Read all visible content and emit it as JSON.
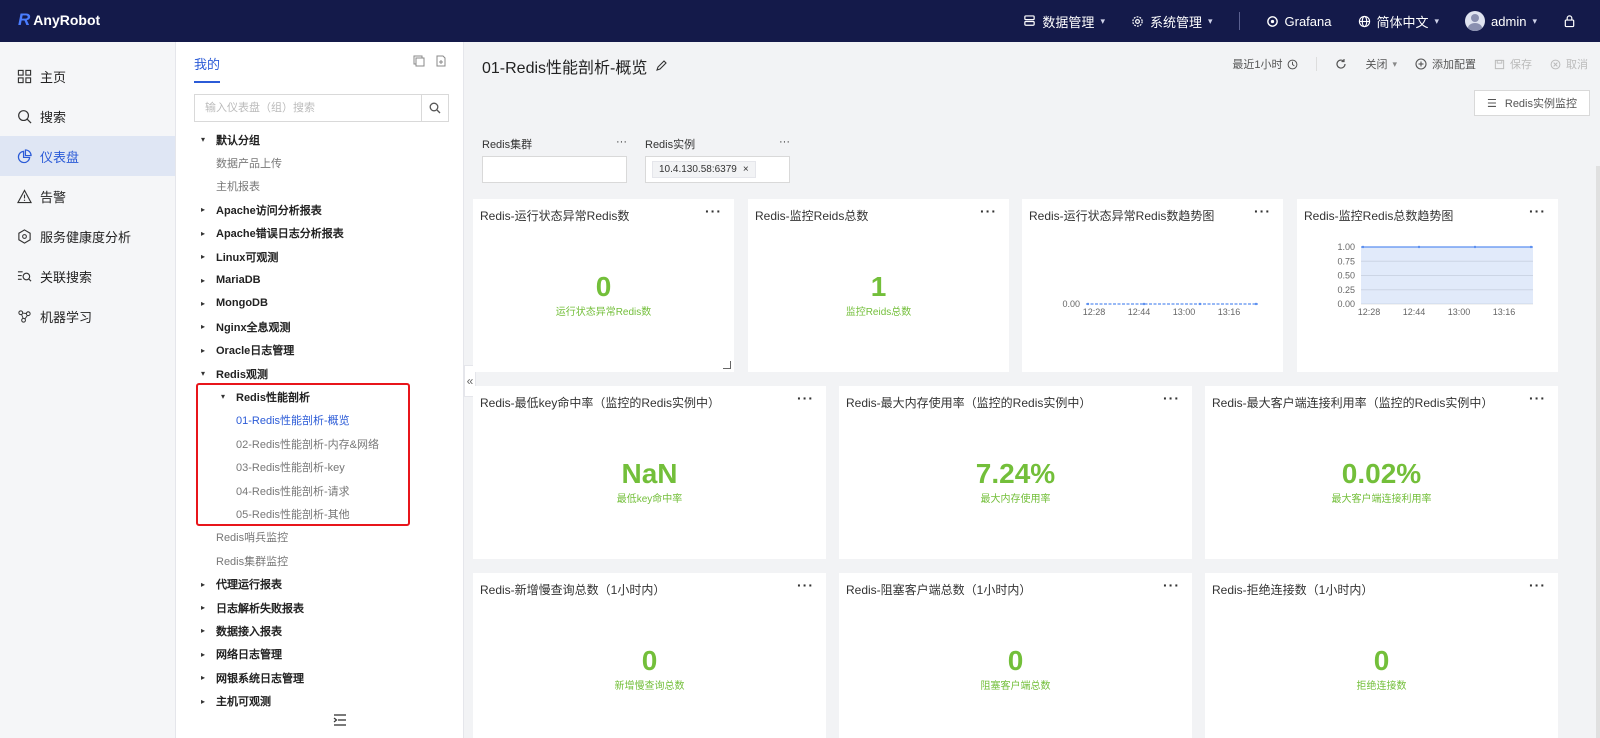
{
  "topbar": {
    "logo_mark": "R",
    "logo_text": "AnyRobot",
    "items": [
      {
        "label": "数据管理",
        "icon": "database-icon"
      },
      {
        "label": "系统管理",
        "icon": "gear-icon"
      },
      {
        "label": "Grafana",
        "icon": "grafana-icon"
      },
      {
        "label": "简体中文",
        "icon": "globe-icon"
      }
    ],
    "user": "admin"
  },
  "leftnav": {
    "items": [
      {
        "label": "主页",
        "icon": "grid-icon"
      },
      {
        "label": "搜索",
        "icon": "search-icon"
      },
      {
        "label": "仪表盘",
        "icon": "pie-chart-icon",
        "active": true
      },
      {
        "label": "告警",
        "icon": "warning-icon"
      },
      {
        "label": "服务健康度分析",
        "icon": "cube-icon"
      },
      {
        "label": "关联搜索",
        "icon": "related-search-icon"
      },
      {
        "label": "机器学习",
        "icon": "ml-icon"
      }
    ]
  },
  "tree": {
    "tab": "我的",
    "search_placeholder": "输入仪表盘（组）搜索",
    "rows": [
      {
        "label": "默认分组",
        "kind": "lv0",
        "arrow": "▾"
      },
      {
        "label": "数据产品上传",
        "kind": "leaf0"
      },
      {
        "label": "主机报表",
        "kind": "leaf0"
      },
      {
        "label": "Apache访问分析报表",
        "kind": "lv0",
        "arrow": "▸"
      },
      {
        "label": "Apache错误日志分析报表",
        "kind": "lv0",
        "arrow": "▸"
      },
      {
        "label": "Linux可观测",
        "kind": "lv0",
        "arrow": "▸"
      },
      {
        "label": "MariaDB",
        "kind": "lv0",
        "arrow": "▸"
      },
      {
        "label": "MongoDB",
        "kind": "lv0",
        "arrow": "▸"
      },
      {
        "label": "Nginx全息观测",
        "kind": "lv0",
        "arrow": "▸"
      },
      {
        "label": "Oracle日志管理",
        "kind": "lv0",
        "arrow": "▸"
      },
      {
        "label": "Redis观测",
        "kind": "lv0",
        "arrow": "▾"
      },
      {
        "label": "Redis性能剖析",
        "kind": "lv1",
        "arrow": "▾"
      },
      {
        "label": "01-Redis性能剖析-概览",
        "kind": "leaf1",
        "selected": true
      },
      {
        "label": "02-Redis性能剖析-内存&网络",
        "kind": "leaf1"
      },
      {
        "label": "03-Redis性能剖析-key",
        "kind": "leaf1"
      },
      {
        "label": "04-Redis性能剖析-请求",
        "kind": "leaf1"
      },
      {
        "label": "05-Redis性能剖析-其他",
        "kind": "leaf1"
      },
      {
        "label": "Redis哨兵监控",
        "kind": "leaf0"
      },
      {
        "label": "Redis集群监控",
        "kind": "leaf0"
      },
      {
        "label": "代理运行报表",
        "kind": "lv0",
        "arrow": "▸"
      },
      {
        "label": "日志解析失败报表",
        "kind": "lv0",
        "arrow": "▸"
      },
      {
        "label": "数据接入报表",
        "kind": "lv0",
        "arrow": "▸"
      },
      {
        "label": "网络日志管理",
        "kind": "lv0",
        "arrow": "▸"
      },
      {
        "label": "网银系统日志管理",
        "kind": "lv0",
        "arrow": "▸"
      },
      {
        "label": "主机可观测",
        "kind": "lv0",
        "arrow": "▸"
      }
    ]
  },
  "main": {
    "title": "01-Redis性能剖析-概览",
    "toolbar": {
      "time_range": "最近1小时",
      "refresh": "关闭",
      "add_config": "添加配置",
      "save": "保存",
      "cancel": "取消"
    },
    "redis_btn": "Redis实例监控",
    "vars": [
      {
        "label": "Redis集群",
        "value": ""
      },
      {
        "label": "Redis实例",
        "value": "10.4.130.58:6379"
      }
    ],
    "panels": [
      {
        "title": "Redis-运行状态异常Redis数",
        "value": "0",
        "label": "运行状态异常Redis数"
      },
      {
        "title": "Redis-监控Reids总数",
        "value": "1",
        "label": "监控Reids总数"
      },
      {
        "title": "Redis-运行状态异常Redis数趋势图"
      },
      {
        "title": "Redis-监控Redis总数趋势图"
      },
      {
        "title": "Redis-最低key命中率（监控的Redis实例中）",
        "value": "NaN",
        "label": "最低key命中率"
      },
      {
        "title": "Redis-最大内存使用率（监控的Redis实例中）",
        "value": "7.24%",
        "label": "最大内存使用率"
      },
      {
        "title": "Redis-最大客户端连接利用率（监控的Redis实例中）",
        "value": "0.02%",
        "label": "最大客户端连接利用率"
      },
      {
        "title": "Redis-新增慢查询总数（1小时内）",
        "value": "0",
        "label": "新增慢查询总数"
      },
      {
        "title": "Redis-阻塞客户端总数（1小时内）",
        "value": "0",
        "label": "阻塞客户端总数"
      },
      {
        "title": "Redis-拒绝连接数（1小时内）",
        "value": "0",
        "label": "拒绝连接数"
      }
    ]
  },
  "chart_data": [
    {
      "type": "line",
      "x": [
        "12:28",
        "12:44",
        "13:00",
        "13:16"
      ],
      "yticks": [
        "0.00"
      ],
      "values": [
        0,
        0,
        0,
        0
      ]
    },
    {
      "type": "area",
      "x": [
        "12:28",
        "12:44",
        "13:00",
        "13:16"
      ],
      "yticks": [
        "0.00",
        "0.25",
        "0.50",
        "0.75",
        "1.00"
      ],
      "ylim": [
        0,
        1
      ],
      "values": [
        1,
        1,
        1,
        1
      ]
    }
  ]
}
